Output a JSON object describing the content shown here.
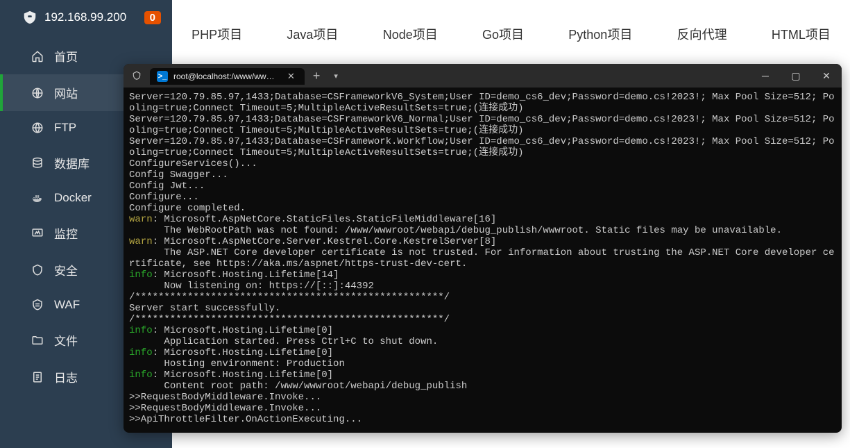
{
  "sidebar": {
    "ip": "192.168.99.200",
    "badge": "0",
    "items": [
      {
        "label": "首页",
        "icon": "home"
      },
      {
        "label": "网站",
        "icon": "globe"
      },
      {
        "label": "FTP",
        "icon": "ftp"
      },
      {
        "label": "数据库",
        "icon": "database"
      },
      {
        "label": "Docker",
        "icon": "docker"
      },
      {
        "label": "监控",
        "icon": "monitor"
      },
      {
        "label": "安全",
        "icon": "shield"
      },
      {
        "label": "WAF",
        "icon": "waf"
      },
      {
        "label": "文件",
        "icon": "folder"
      },
      {
        "label": "日志",
        "icon": "log"
      }
    ]
  },
  "tabs": [
    "PHP项目",
    "Java项目",
    "Node项目",
    "Go项目",
    "Python项目",
    "反向代理",
    "HTML项目"
  ],
  "terminal": {
    "tab_title": "root@localhost:/www/wwwro",
    "lines": [
      {
        "t": "plain",
        "s": "Server=120.79.85.97,1433;Database=CSFrameworkV6_System;User ID=demo_cs6_dev;Password=demo.cs!2023!; Max Pool Size=512; Pooling=true;Connect Timeout=5;MultipleActiveResultSets=true;(连接成功)"
      },
      {
        "t": "plain",
        "s": "Server=120.79.85.97,1433;Database=CSFrameworkV6_Normal;User ID=demo_cs6_dev;Password=demo.cs!2023!; Max Pool Size=512; Pooling=true;Connect Timeout=5;MultipleActiveResultSets=true;(连接成功)"
      },
      {
        "t": "plain",
        "s": "Server=120.79.85.97,1433;Database=CSFramework.Workflow;User ID=demo_cs6_dev;Password=demo.cs!2023!; Max Pool Size=512; Pooling=true;Connect Timeout=5;MultipleActiveResultSets=true;(连接成功)"
      },
      {
        "t": "plain",
        "s": "ConfigureServices()..."
      },
      {
        "t": "plain",
        "s": "Config Swagger..."
      },
      {
        "t": "plain",
        "s": "Config Jwt..."
      },
      {
        "t": "plain",
        "s": "Configure..."
      },
      {
        "t": "plain",
        "s": "Configure completed."
      },
      {
        "t": "warn",
        "s": ": Microsoft.AspNetCore.StaticFiles.StaticFileMiddleware[16]"
      },
      {
        "t": "plain",
        "s": "      The WebRootPath was not found: /www/wwwroot/webapi/debug_publish/wwwroot. Static files may be unavailable."
      },
      {
        "t": "warn",
        "s": ": Microsoft.AspNetCore.Server.Kestrel.Core.KestrelServer[8]"
      },
      {
        "t": "plain",
        "s": "      The ASP.NET Core developer certificate is not trusted. For information about trusting the ASP.NET Core developer certificate, see https://aka.ms/aspnet/https-trust-dev-cert."
      },
      {
        "t": "info",
        "s": ": Microsoft.Hosting.Lifetime[14]"
      },
      {
        "t": "plain",
        "s": "      Now listening on: https://[::]:44392"
      },
      {
        "t": "plain",
        "s": "/*****************************************************/"
      },
      {
        "t": "plain",
        "s": "Server start successfully."
      },
      {
        "t": "plain",
        "s": "/*****************************************************/"
      },
      {
        "t": "info",
        "s": ": Microsoft.Hosting.Lifetime[0]"
      },
      {
        "t": "plain",
        "s": "      Application started. Press Ctrl+C to shut down."
      },
      {
        "t": "info",
        "s": ": Microsoft.Hosting.Lifetime[0]"
      },
      {
        "t": "plain",
        "s": "      Hosting environment: Production"
      },
      {
        "t": "info",
        "s": ": Microsoft.Hosting.Lifetime[0]"
      },
      {
        "t": "plain",
        "s": "      Content root path: /www/wwwroot/webapi/debug_publish"
      },
      {
        "t": "plain",
        "s": ">>RequestBodyMiddleware.Invoke..."
      },
      {
        "t": "plain",
        "s": ">>RequestBodyMiddleware.Invoke..."
      },
      {
        "t": "plain",
        "s": ">>ApiThrottleFilter.OnActionExecuting..."
      }
    ]
  }
}
